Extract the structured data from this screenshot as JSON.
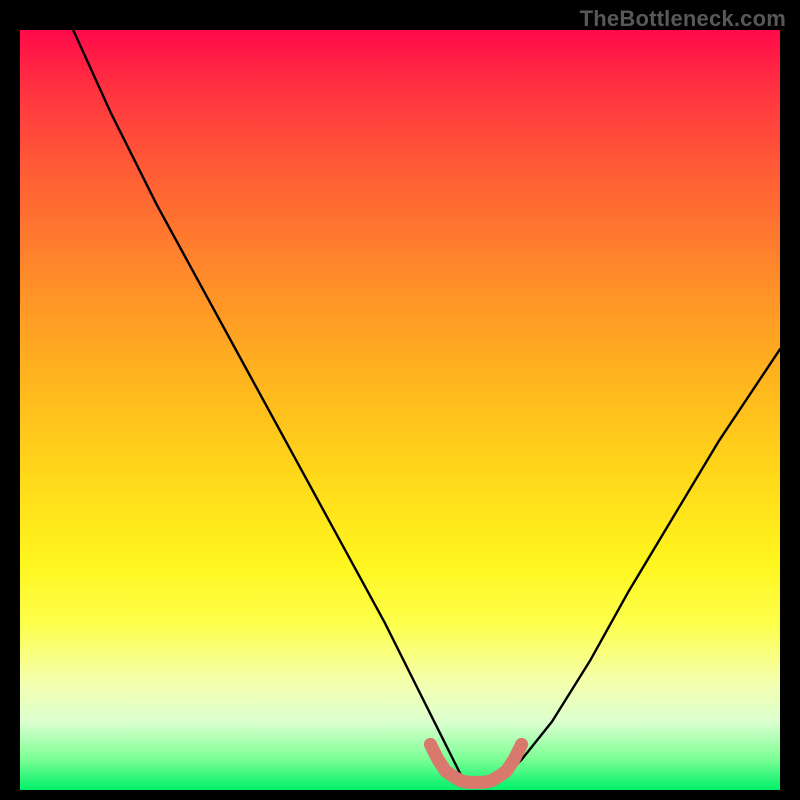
{
  "watermark": {
    "text": "TheBottleneck.com"
  },
  "chart_data": {
    "type": "line",
    "title": "",
    "xlabel": "",
    "ylabel": "",
    "xlim": [
      0,
      100
    ],
    "ylim": [
      0,
      100
    ],
    "grid": false,
    "legend": false,
    "annotations": [],
    "series": [
      {
        "name": "bottleneck-curve",
        "color": "#000000",
        "x": [
          7,
          12,
          18,
          24,
          30,
          36,
          42,
          48,
          52,
          55,
          57,
          58,
          60,
          62,
          64,
          66,
          70,
          75,
          80,
          86,
          92,
          100
        ],
        "y": [
          100,
          89,
          77,
          66,
          55,
          44,
          33,
          22,
          14,
          8,
          4,
          2,
          1,
          1,
          2,
          4,
          9,
          17,
          26,
          36,
          46,
          58
        ]
      },
      {
        "name": "optimal-band",
        "color": "#d9786d",
        "x": [
          54,
          55,
          56,
          57,
          58,
          59,
          60,
          61,
          62,
          63,
          64,
          65,
          66
        ],
        "y": [
          6,
          4,
          2.5,
          1.8,
          1.2,
          1,
          1,
          1,
          1.2,
          1.8,
          2.5,
          4,
          6
        ]
      }
    ]
  },
  "colors": {
    "background": "#000000",
    "gradient_top": "#ff0a4a",
    "gradient_bottom": "#00ef6a",
    "curve": "#000000",
    "band": "#d9786d",
    "watermark": "#585858"
  }
}
